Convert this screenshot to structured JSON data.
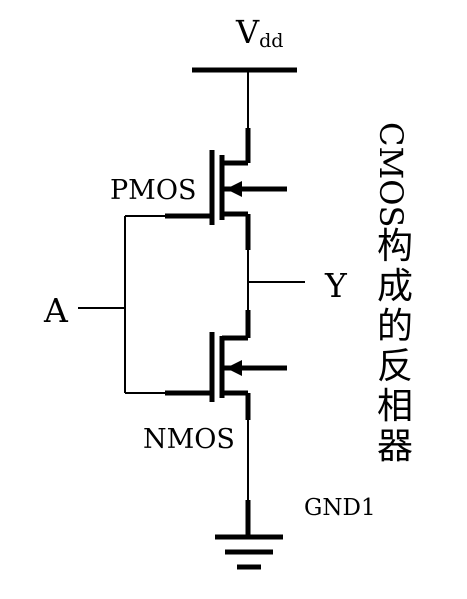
{
  "labels": {
    "vdd_main": "V",
    "vdd_sub": "dd",
    "pmos": "PMOS",
    "nmos": "NMOS",
    "input": "A",
    "output": "Y",
    "ground": "GND1",
    "caption_latin": "CMOS",
    "caption_chars": [
      "构",
      "成",
      "的",
      "反",
      "相",
      "器"
    ]
  },
  "colors": {
    "wire": "#000000",
    "background": "#ffffff"
  }
}
